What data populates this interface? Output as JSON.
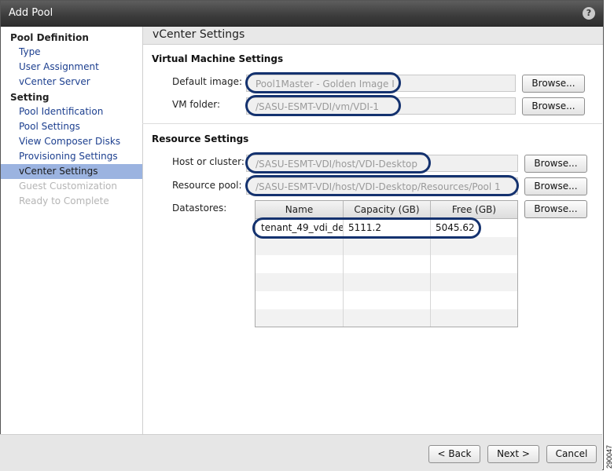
{
  "window": {
    "title": "Add Pool"
  },
  "sidebar": {
    "sections": [
      {
        "heading": "Pool Definition",
        "items": [
          "Type",
          "User Assignment",
          "vCenter Server"
        ]
      },
      {
        "heading": "Setting",
        "items": [
          "Pool Identification",
          "Pool Settings",
          "View Composer Disks",
          "Provisioning Settings",
          "vCenter Settings",
          "Guest Customization",
          "Ready to Complete"
        ]
      }
    ],
    "active_item": "vCenter Settings",
    "disabled_items": [
      "Guest Customization",
      "Ready to Complete"
    ]
  },
  "main": {
    "title": "vCenter Settings",
    "vm_settings": {
      "heading": "Virtual Machine Settings",
      "default_image_label": "Default image:",
      "default_image_value": "Pool1Master - Golden Image I",
      "vm_folder_label": "VM folder:",
      "vm_folder_value": "/SASU-ESMT-VDI/vm/VDI-1"
    },
    "resource_settings": {
      "heading": "Resource Settings",
      "host_label": "Host or cluster:",
      "host_value": "/SASU-ESMT-VDI/host/VDI-Desktop",
      "pool_label": "Resource pool:",
      "pool_value": "/SASU-ESMT-VDI/host/VDI-Desktop/Resources/Pool 1",
      "datastores_label": "Datastores:"
    },
    "browse_label": "Browse...",
    "datastores": {
      "columns": [
        "Name",
        "Capacity (GB)",
        "Free (GB)"
      ],
      "rows": [
        {
          "name": "tenant_49_vdi_de",
          "capacity": "5111.2",
          "free": "5045.62"
        }
      ]
    }
  },
  "footer": {
    "back_label": "< Back",
    "next_label": "Next >",
    "cancel_label": "Cancel"
  },
  "figure_number": "290047",
  "colors": {
    "active_item_bg": "#9bb3e0",
    "highlight_oval": "#14326f",
    "link": "#1c3f8f"
  },
  "icons": {
    "help": "question-mark-icon"
  }
}
